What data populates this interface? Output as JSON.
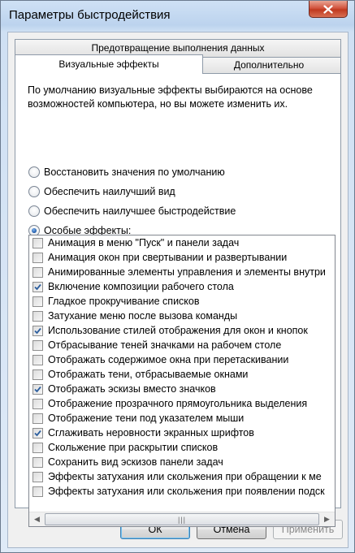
{
  "window": {
    "title": "Параметры быстродействия"
  },
  "tabs": {
    "back": "Предотвращение выполнения данных",
    "active": "Визуальные эффекты",
    "advanced": "Дополнительно"
  },
  "description": "По умолчанию визуальные эффекты выбираются на основе возможностей компьютера, но вы можете изменить их.",
  "radios": [
    {
      "label": "Восстановить значения по умолчанию",
      "checked": false
    },
    {
      "label": "Обеспечить наилучший вид",
      "checked": false
    },
    {
      "label": "Обеспечить наилучшее быстродействие",
      "checked": false
    },
    {
      "label": "Особые эффекты:",
      "checked": true
    }
  ],
  "effects": [
    {
      "label": "Анимация в меню \"Пуск\" и панели задач",
      "checked": false
    },
    {
      "label": "Анимация окон при свертывании и развертывании",
      "checked": false
    },
    {
      "label": "Анимированные элементы управления и элементы внутри",
      "checked": false
    },
    {
      "label": "Включение композиции рабочего стола",
      "checked": true
    },
    {
      "label": "Гладкое прокручивание списков",
      "checked": false
    },
    {
      "label": "Затухание меню после вызова команды",
      "checked": false
    },
    {
      "label": "Использование стилей отображения для окон и кнопок",
      "checked": true
    },
    {
      "label": "Отбрасывание теней значками на рабочем столе",
      "checked": false
    },
    {
      "label": "Отображать содержимое окна при перетаскивании",
      "checked": false
    },
    {
      "label": "Отображать тени, отбрасываемые окнами",
      "checked": false
    },
    {
      "label": "Отображать эскизы вместо значков",
      "checked": true
    },
    {
      "label": "Отображение прозрачного прямоугольника выделения",
      "checked": false
    },
    {
      "label": "Отображение тени под указателем мыши",
      "checked": false
    },
    {
      "label": "Сглаживать неровности экранных шрифтов",
      "checked": true
    },
    {
      "label": "Скольжение при раскрытии списков",
      "checked": false
    },
    {
      "label": "Сохранить вид эскизов панели задач",
      "checked": false
    },
    {
      "label": "Эффекты затухания или скольжения при обращении к ме",
      "checked": false
    },
    {
      "label": "Эффекты затухания или скольжения при появлении подск",
      "checked": false
    }
  ],
  "scrollbar": {
    "thumb_glyph": "|||"
  },
  "buttons": {
    "ok": "ОК",
    "cancel": "Отмена",
    "apply": "Применить"
  },
  "colors": {
    "close_button": "#c0391f",
    "accent_radio": "#1e58a6"
  },
  "icons": {
    "close": "close-icon",
    "scroll_left": "arrow-left-icon",
    "scroll_right": "arrow-right-icon"
  }
}
